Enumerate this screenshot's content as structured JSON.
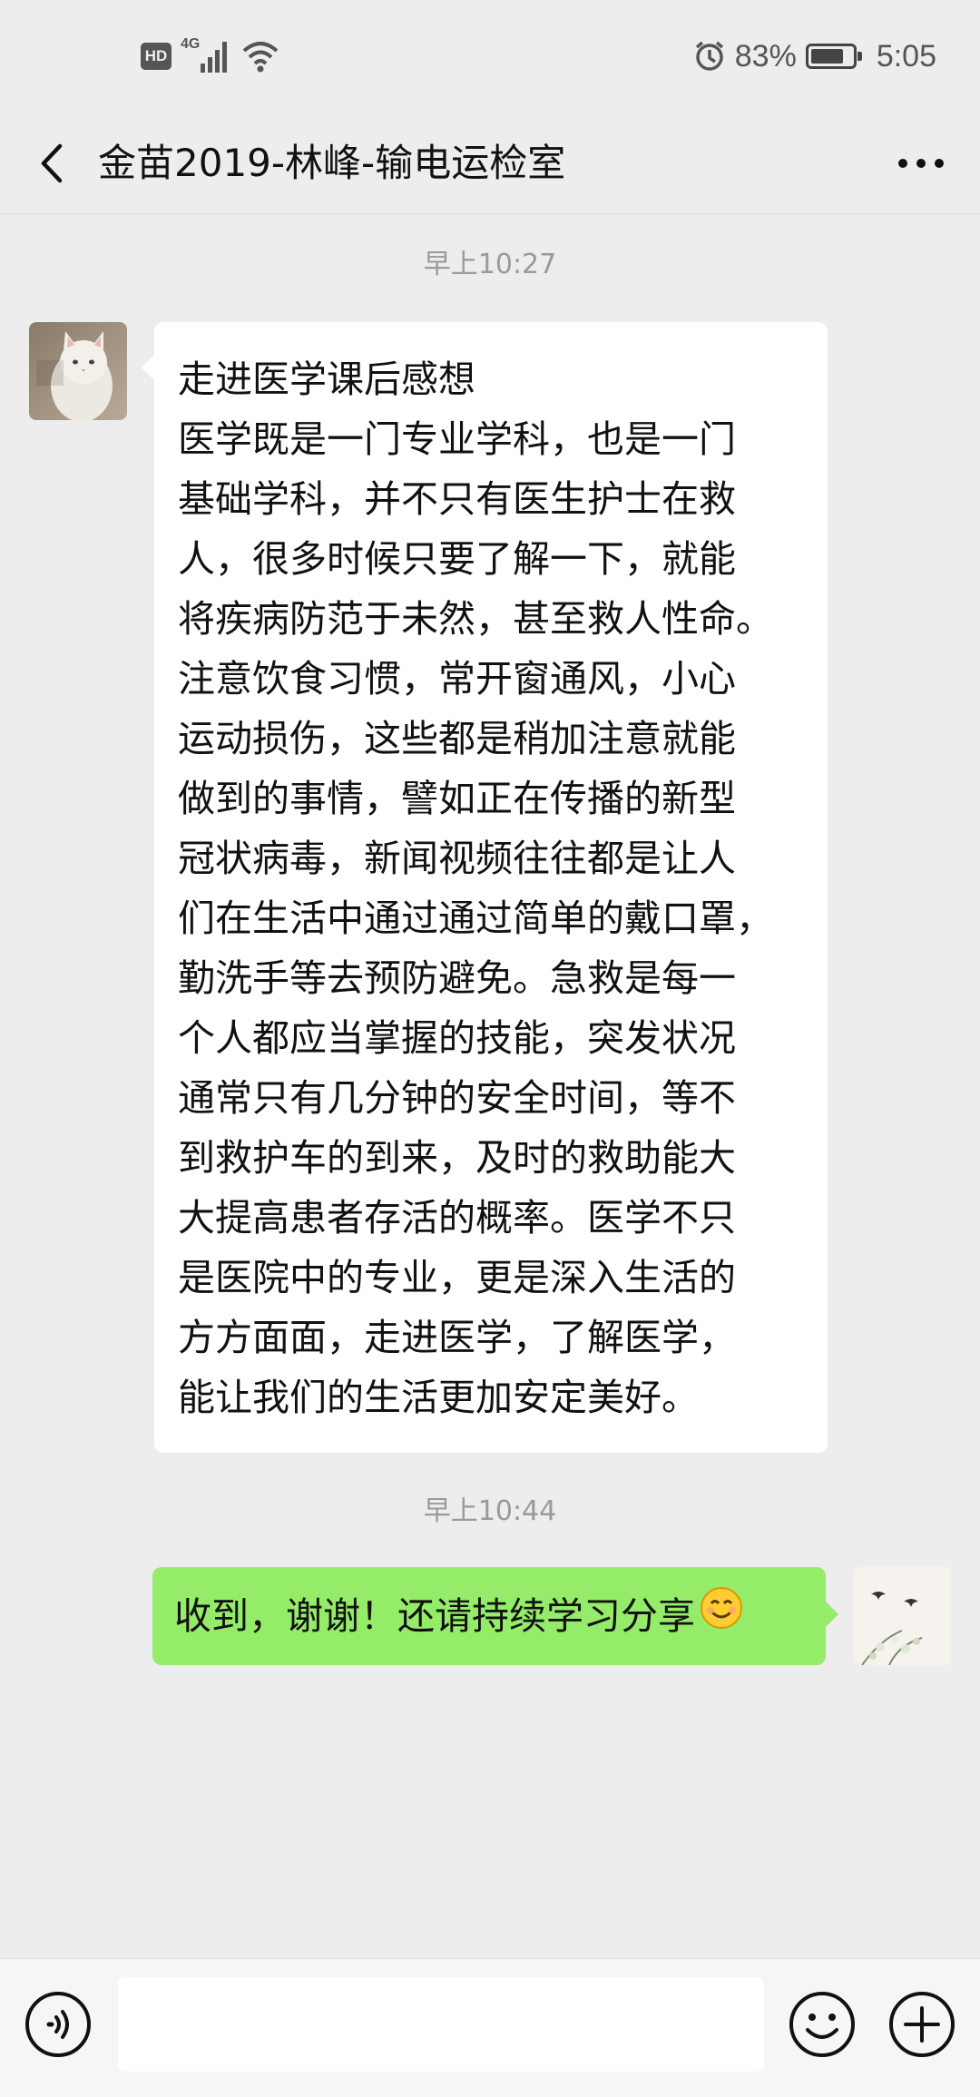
{
  "status_bar": {
    "hd": "HD",
    "network": "4G",
    "battery_text": "83%",
    "battery_level": 0.83,
    "time": "5:05"
  },
  "header": {
    "title": "金苗2019-林峰-输电运检室"
  },
  "messages": [
    {
      "timestamp": "早上10:27",
      "direction": "incoming",
      "lines": [
        "走进医学课后感想",
        "医学既是一门专业学科，也是一门",
        "基础学科，并不只有医生护士在救",
        "人，很多时候只要了解一下，就能",
        "将疾病防范于未然，甚至救人性命。",
        "注意饮食习惯，常开窗通风，小心",
        "运动损伤，这些都是稍加注意就能",
        "做到的事情，譬如正在传播的新型",
        "冠状病毒，新闻视频往往都是让人",
        "们在生活中通过通过简单的戴口罩，",
        "勤洗手等去预防避免。急救是每一",
        "个人都应当掌握的技能，突发状况",
        "通常只有几分钟的安全时间，等不",
        "到救护车的到来，及时的救助能大",
        "大提高患者存活的概率。医学不只",
        "是医院中的专业，更是深入生活的",
        "方方面面，走进医学，了解医学，",
        "能让我们的生活更加安定美好。"
      ]
    },
    {
      "timestamp": "早上10:44",
      "direction": "outgoing",
      "text": "收到，谢谢！还请持续学习分享",
      "emoji": "smile-emoji"
    }
  ],
  "input_bar": {
    "value": ""
  },
  "colors": {
    "background": "#ededed",
    "incoming_bubble": "#ffffff",
    "outgoing_bubble": "#95ec69",
    "timestamp": "#9a9a9a"
  },
  "icons": {
    "back": "chevron-left-icon",
    "more": "more-dots-icon",
    "voice": "voice-icon",
    "emoji": "emoji-icon",
    "plus": "plus-icon"
  }
}
